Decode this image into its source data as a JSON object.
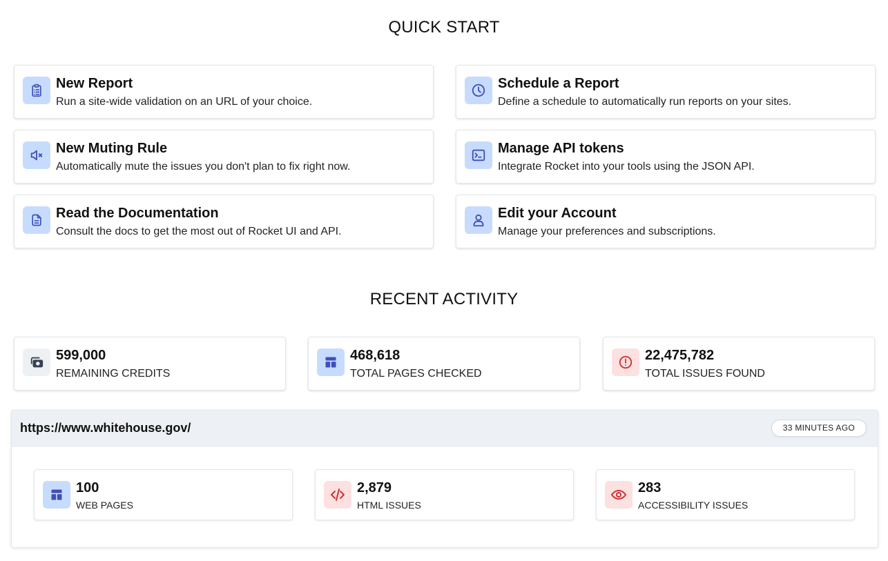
{
  "quick_start": {
    "title": "QUICK START",
    "cards": [
      {
        "title": "New Report",
        "desc": "Run a site-wide validation on an URL of your choice.",
        "icon": "clipboard-list-icon"
      },
      {
        "title": "Schedule a Report",
        "desc": "Define a schedule to automatically run reports on your sites.",
        "icon": "clock-icon"
      },
      {
        "title": "New Muting Rule",
        "desc": "Automatically mute the issues you don't plan to fix right now.",
        "icon": "volume-mute-icon"
      },
      {
        "title": "Manage API tokens",
        "desc": "Integrate Rocket into your tools using the JSON API.",
        "icon": "terminal-icon"
      },
      {
        "title": "Read the Documentation",
        "desc": "Consult the docs to get the most out of Rocket UI and API.",
        "icon": "document-icon"
      },
      {
        "title": "Edit your Account",
        "desc": "Manage your preferences and subscriptions.",
        "icon": "user-icon"
      }
    ]
  },
  "recent_activity": {
    "title": "RECENT ACTIVITY",
    "stats": [
      {
        "value": "599,000",
        "label": "REMAINING CREDITS",
        "icon": "credits-icon"
      },
      {
        "value": "468,618",
        "label": "TOTAL PAGES CHECKED",
        "icon": "layout-icon"
      },
      {
        "value": "22,475,782",
        "label": "TOTAL ISSUES FOUND",
        "icon": "alert-circle-icon"
      }
    ],
    "report": {
      "url": "https://www.whitehouse.gov/",
      "time": "33 MINUTES AGO",
      "stats": [
        {
          "value": "100",
          "label": "WEB PAGES",
          "icon": "layout-icon"
        },
        {
          "value": "2,879",
          "label": "HTML ISSUES",
          "icon": "code-icon"
        },
        {
          "value": "283",
          "label": "ACCESSIBILITY ISSUES",
          "icon": "eye-icon"
        }
      ]
    }
  },
  "colors": {
    "icon_blue": "#3f4fb8",
    "icon_red": "#d32f2f",
    "icon_bg_blue": "#c7dcfd",
    "icon_bg_red": "#fde0e0",
    "icon_bg_gray": "#eef1f4",
    "header_bg": "#edf1f5"
  }
}
